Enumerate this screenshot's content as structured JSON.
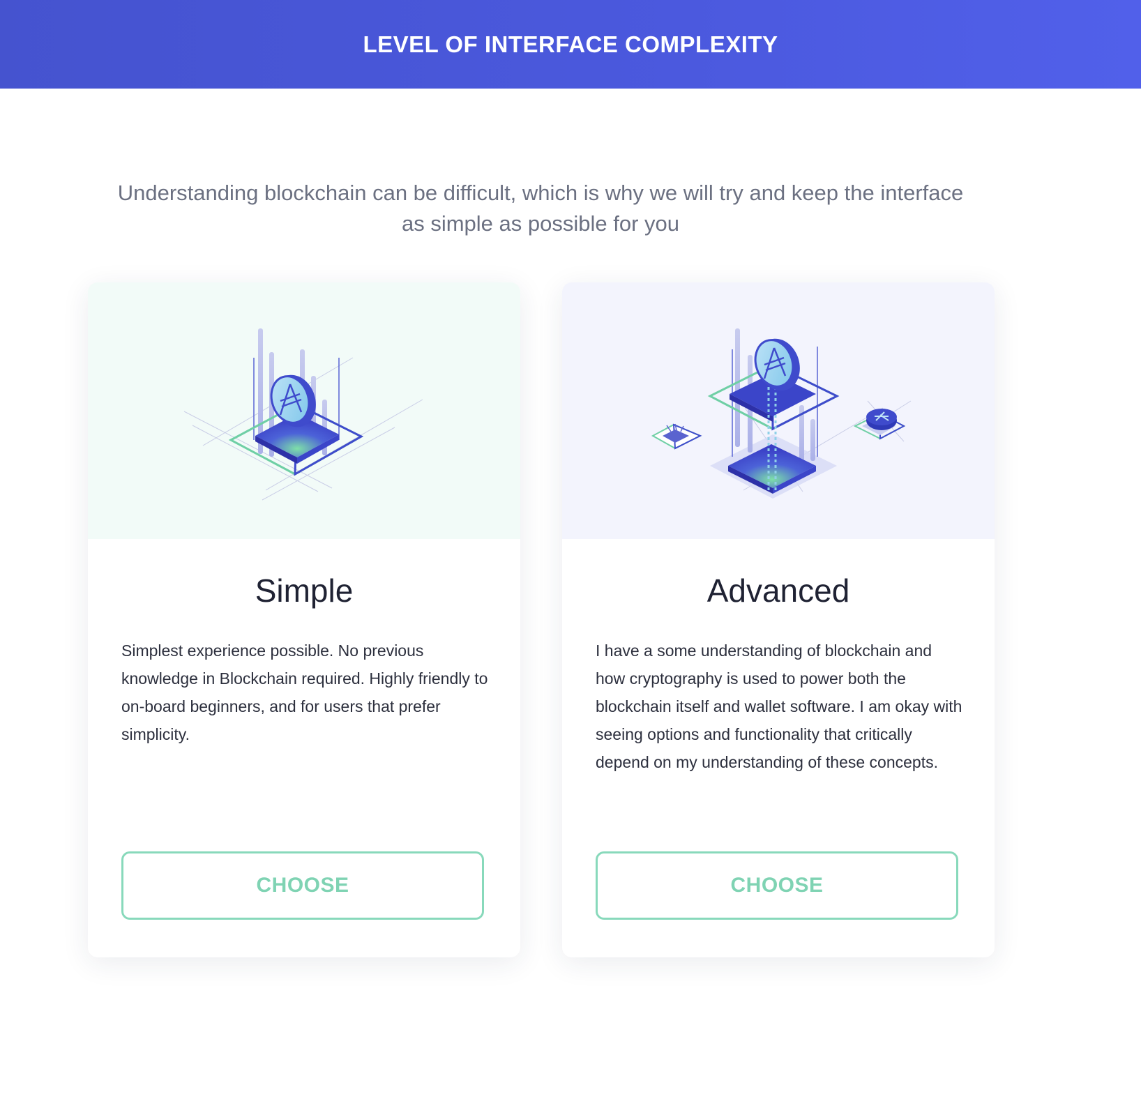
{
  "header": {
    "title": "LEVEL OF INTERFACE COMPLEXITY"
  },
  "intro": {
    "text": "Understanding blockchain can be difficult, which is why we will try and keep the interface as simple as possible for you"
  },
  "cards": [
    {
      "title": "Simple",
      "description": "Simplest experience possible. No previous knowledge in Blockchain required. Highly friendly to on-board beginners, and for users that prefer simplicity.",
      "button_label": "CHOOSE",
      "illustration_bg": "#f2fbf8"
    },
    {
      "title": "Advanced",
      "description": "I have a some understanding of blockchain and how cryptography is used to power both the blockchain itself and wallet software. I am okay with seeing options and functionality that critically depend on my understanding of these concepts.",
      "button_label": "CHOOSE",
      "illustration_bg": "#f3f4fd"
    }
  ],
  "colors": {
    "header_gradient_start": "#4553cf",
    "header_gradient_end": "#5160ea",
    "accent_green": "#7fd3b3",
    "accent_blue": "#3b45c9"
  }
}
